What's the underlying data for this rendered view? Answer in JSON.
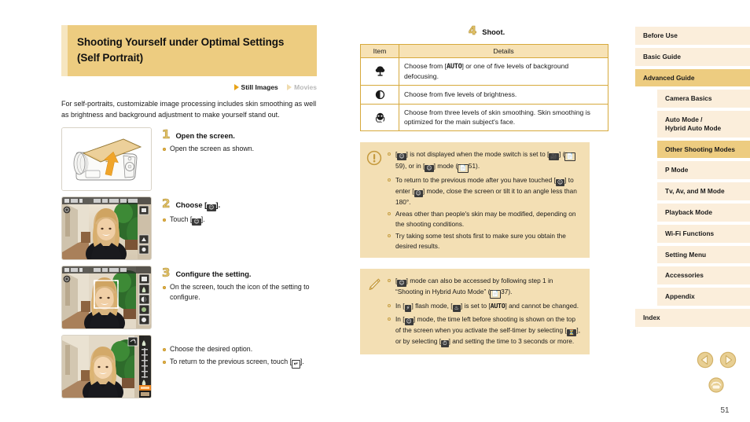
{
  "document": {
    "page_number": "51"
  },
  "left": {
    "title": "Shooting Yourself under Optimal Settings (Self Portrait)",
    "media_tags": [
      {
        "label": "Still Images",
        "enabled": true
      },
      {
        "label": "Movies",
        "enabled": false
      }
    ],
    "intro": "For self-portraits, customizable image processing includes skin smoothing as well as brightness and background adjustment to make yourself stand out.",
    "steps": [
      {
        "number": "1",
        "title": "Open the screen.",
        "bullets": [
          "Open the screen as shown."
        ],
        "figure": "camera-screen-tilt-illustration"
      },
      {
        "number": "2",
        "title": "Choose [ ].",
        "title_plain": "Choose [self-portrait].",
        "bullets": [
          "Touch [self-portrait icon]."
        ],
        "figure": "live-view-portrait-screenshot"
      },
      {
        "number": "3",
        "title": "Configure the setting.",
        "bullets": [
          "On the screen, touch the icon of the setting to configure."
        ],
        "extra_bullets": [
          "Choose the desired option.",
          "To return to the previous screen, touch [return icon]."
        ],
        "figure": "live-view-face-frame-screenshot",
        "figure2": "live-view-slider-screenshot"
      }
    ]
  },
  "middle": {
    "step4": {
      "number": "4",
      "title": "Shoot."
    },
    "table": {
      "headers": [
        "Item",
        "Details"
      ],
      "rows": [
        {
          "icon": "background-defocus-icon",
          "details": "Choose from [AUTO] or one of five levels of background defocusing."
        },
        {
          "icon": "brightness-icon",
          "details": "Choose from five levels of brightness."
        },
        {
          "icon": "skin-smoothing-icon",
          "details": "Choose from three levels of skin smoothing. Skin smoothing is optimized for the main subject's face."
        }
      ]
    },
    "caution": {
      "icon": "exclamation-icon",
      "items": [
        "[self-portrait] is not displayed when the mode switch is set to [movie] ( 59), or in [hybrid auto] mode ( 51).",
        "To return to the previous mode after you have touched [self-portrait] to enter [self-portrait] mode, close the screen or tilt it to an angle less than 180°.",
        "Areas other than people's skin may be modified, depending on the shooting conditions.",
        "Try taking some test shots first to make sure you obtain the desired results."
      ]
    },
    "note": {
      "icon": "pencil-icon",
      "items": [
        "[self-portrait] mode can also be accessed by following step 1 in “Shooting in Hybrid Auto Mode” ( 37).",
        "In [flash] flash mode, [background defocus] is set to [AUTO] and cannot be changed.",
        "In [self-portrait] mode, the time left before shooting is shown on the top of the screen when you activate the self-timer by selecting [face self-timer], or by selecting [self-timer] and setting the time to 3 seconds or more."
      ]
    }
  },
  "sidebar": {
    "items": [
      {
        "label": "Before Use",
        "level": 0,
        "active": false
      },
      {
        "label": "Basic Guide",
        "level": 0,
        "active": false
      },
      {
        "label": "Advanced Guide",
        "level": 0,
        "active": true
      },
      {
        "label": "Camera Basics",
        "level": 1,
        "active": false
      },
      {
        "label": "Auto Mode /\nHybrid Auto Mode",
        "level": 1,
        "active": false,
        "two_line": true
      },
      {
        "label": "Other Shooting Modes",
        "level": 1,
        "active": true
      },
      {
        "label": "P Mode",
        "level": 1,
        "active": false
      },
      {
        "label": "Tv, Av, and M Mode",
        "level": 1,
        "active": false
      },
      {
        "label": "Playback Mode",
        "level": 1,
        "active": false
      },
      {
        "label": "Wi-Fi Functions",
        "level": 1,
        "active": false
      },
      {
        "label": "Setting Menu",
        "level": 1,
        "active": false
      },
      {
        "label": "Accessories",
        "level": 1,
        "active": false
      },
      {
        "label": "Appendix",
        "level": 1,
        "active": false
      },
      {
        "label": "Index",
        "level": 0,
        "active": false
      }
    ]
  },
  "bottom_nav": {
    "prev": "previous-page-arrow",
    "next": "next-page-arrow",
    "home": "home-icon"
  },
  "colors": {
    "banner": "#edcc80",
    "sidebar_item": "#fbeedb",
    "sidebar_active": "#edcc80",
    "notice_bg": "#f3dfb4",
    "table_header": "#f7e2b5",
    "table_border": "#d6a93c",
    "accent": "#e8a317"
  }
}
